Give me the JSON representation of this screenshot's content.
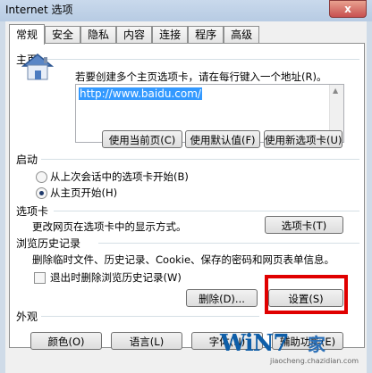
{
  "window": {
    "title": "Internet 选项",
    "close_label": "x"
  },
  "tabs": [
    "常规",
    "安全",
    "隐私",
    "内容",
    "连接",
    "程序",
    "高级"
  ],
  "home": {
    "section": "主页",
    "instruction": "若要创建多个主页选项卡，请在每行键入一个地址(R)。",
    "url": "http://www.baidu.com/",
    "btn_current": "使用当前页(C)",
    "btn_default": "使用默认值(F)",
    "btn_newtab": "使用新选项卡(U)"
  },
  "startup": {
    "section": "启动",
    "option1": "从上次会话中的选项卡开始(B)",
    "option2": "从主页开始(H)"
  },
  "tabs_section": {
    "section": "选项卡",
    "desc": "更改网页在选项卡中的显示方式。",
    "btn": "选项卡(T)"
  },
  "history": {
    "section": "浏览历史记录",
    "desc": "删除临时文件、历史记录、Cookie、保存的密码和网页表单信息。",
    "checkbox": "退出时删除浏览历史记录(W)",
    "btn_delete": "删除(D)...",
    "btn_settings": "设置(S)"
  },
  "appearance": {
    "section": "外观",
    "btn_colors": "颜色(O)",
    "btn_languages": "语言(L)",
    "btn_fonts": "字体(N)",
    "btn_accessibility": "辅助功能(E)"
  },
  "watermark": {
    "logo": "WiN7",
    "mark": "家",
    "sub": "jiaocheng.chazidian.com"
  }
}
